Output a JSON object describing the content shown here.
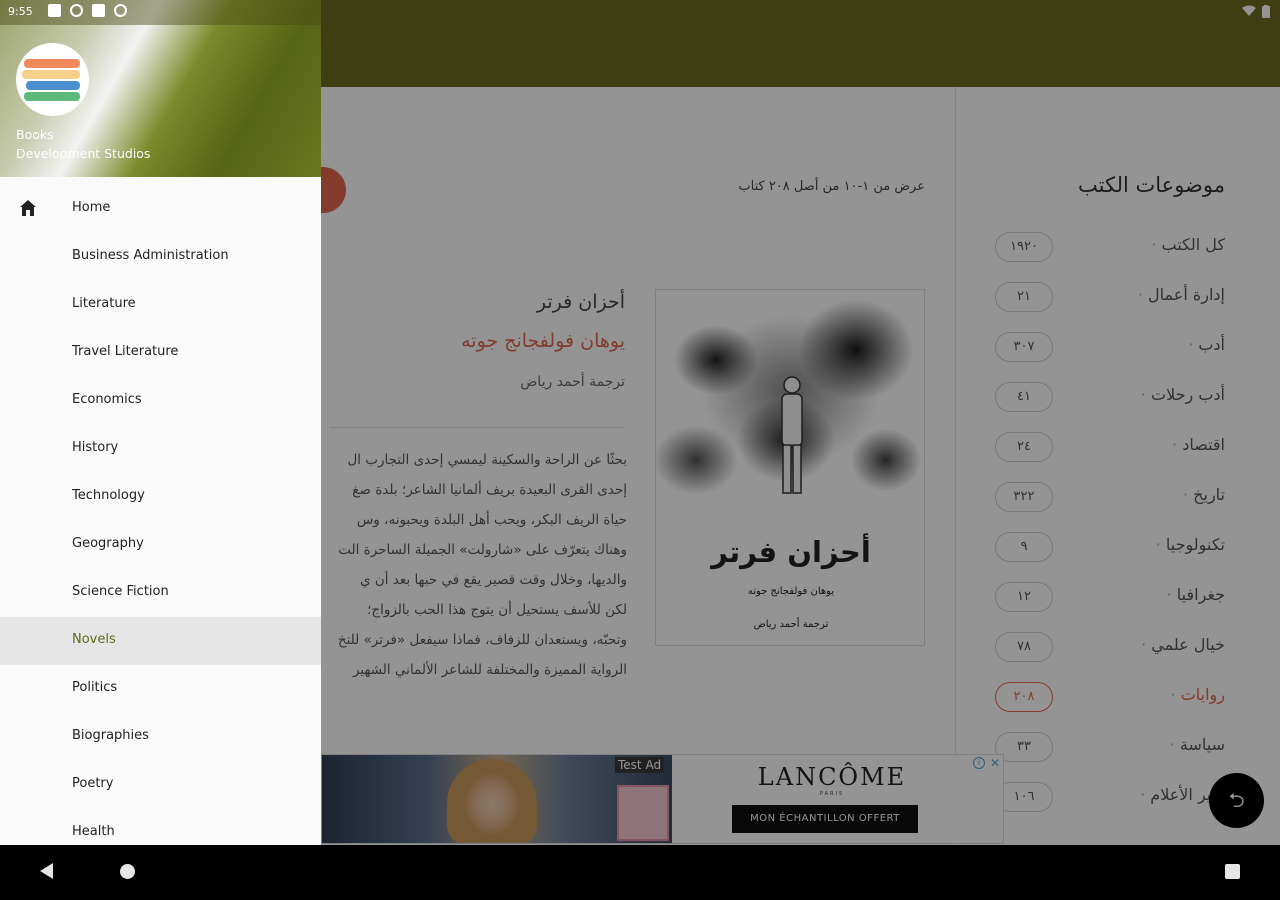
{
  "status": {
    "time": "9:55"
  },
  "drawer": {
    "app_name_line1": "Books",
    "app_name_line2": "Development Studios",
    "items": [
      {
        "label": "Home"
      },
      {
        "label": "Business Administration"
      },
      {
        "label": "Literature"
      },
      {
        "label": "Travel Literature"
      },
      {
        "label": "Economics"
      },
      {
        "label": "History"
      },
      {
        "label": "Technology"
      },
      {
        "label": "Geography"
      },
      {
        "label": "Science Fiction"
      },
      {
        "label": "Novels"
      },
      {
        "label": "Politics"
      },
      {
        "label": "Biographies"
      },
      {
        "label": "Poetry"
      },
      {
        "label": "Health"
      }
    ],
    "active_item": "Novels"
  },
  "topics": {
    "title": "موضوعات الكتب",
    "items": [
      {
        "label": "كل الكتب",
        "count": "١٩٢٠"
      },
      {
        "label": "إدارة أعمال",
        "count": "٢١"
      },
      {
        "label": "أدب",
        "count": "٣٠٧"
      },
      {
        "label": "أدب رحلات",
        "count": "٤١"
      },
      {
        "label": "اقتصاد",
        "count": "٢٤"
      },
      {
        "label": "تاريخ",
        "count": "٣٢٢"
      },
      {
        "label": "تكنولوجيا",
        "count": "٩"
      },
      {
        "label": "جغرافيا",
        "count": "١٢"
      },
      {
        "label": "خيال علمي",
        "count": "٧٨"
      },
      {
        "label": "روايات",
        "count": "٢٠٨",
        "active": true
      },
      {
        "label": "سياسة",
        "count": "٣٣"
      },
      {
        "label": "سير الأعلام",
        "count": "١٠٦"
      }
    ]
  },
  "results_info": "عرض من ١-١٠ من أصل ٢٠٨ كتاب",
  "book": {
    "cover_title": "أحزان فرتر",
    "cover_author": "يوهان فولفجانج جوته",
    "cover_translator": "ترجمة أحمد رياض",
    "title": "أحزان فرتر",
    "author": "يوهان فولفجانج جوته",
    "translator": "ترجمة أحمد رياض",
    "description_lines": [
      "بحثًا عن الراحة والسكينة ليمسي إحدى التجارب ال",
      "إحدى القرى البعيدة بريف ألمانيا الشاعر؛ بلدة صغ",
      "حياة الريف البكر، ويحب أهل البلدة ويحبونه، وس",
      "وهناك يتعرّف على «شارولت» الجميلة الساحرة الت",
      "والديها، وخلال وقت قصير يقع في حبها بعد أن ي",
      "لكن للأسف يستحيل أن يتوج هذا الحب بالزواج؛",
      "وتحبّه، ويستعدان للزفاف، فماذا سيفعل «فرتر» للتخ",
      "الرواية المميزة والمختلفة للشاعر الألماني الشهير"
    ]
  },
  "ad": {
    "badge": "Test Ad",
    "brand": "LANCÔME",
    "brand_sub": "PARIS",
    "cta": "MON ÉCHANTILLON OFFERT"
  }
}
